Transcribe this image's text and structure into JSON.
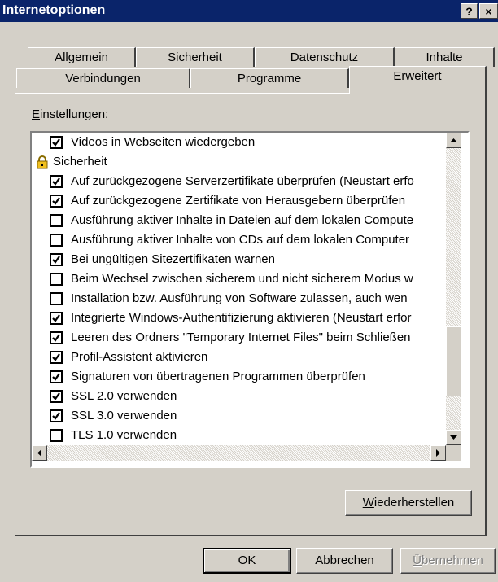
{
  "window": {
    "title": "Internetoptionen",
    "help_button": "?",
    "close_button": "×"
  },
  "tabs": {
    "row_back": [
      "Allgemein",
      "Sicherheit",
      "Datenschutz",
      "Inhalte"
    ],
    "row_front": [
      "Verbindungen",
      "Programme",
      "Erweitert"
    ],
    "active": "Erweitert"
  },
  "settings": {
    "label_accesskey": "E",
    "label_rest": "instellungen:",
    "items": [
      {
        "type": "checkbox",
        "checked": true,
        "label": "Videos in Webseiten wiedergeben"
      },
      {
        "type": "category",
        "icon": "lock-icon",
        "label": "Sicherheit"
      },
      {
        "type": "checkbox",
        "checked": true,
        "label": "Auf zurückgezogene Serverzertifikate überprüfen (Neustart erfo"
      },
      {
        "type": "checkbox",
        "checked": true,
        "label": "Auf zurückgezogene Zertifikate von Herausgebern überprüfen"
      },
      {
        "type": "checkbox",
        "checked": false,
        "label": "Ausführung aktiver Inhalte in Dateien auf dem lokalen Compute"
      },
      {
        "type": "checkbox",
        "checked": false,
        "label": "Ausführung aktiver Inhalte von CDs auf dem lokalen Computer"
      },
      {
        "type": "checkbox",
        "checked": true,
        "label": "Bei ungültigen Sitezertifikaten warnen"
      },
      {
        "type": "checkbox",
        "checked": false,
        "label": "Beim Wechsel zwischen sicherem und nicht sicherem Modus w"
      },
      {
        "type": "checkbox",
        "checked": false,
        "label": "Installation bzw. Ausführung von Software zulassen, auch wen"
      },
      {
        "type": "checkbox",
        "checked": true,
        "label": "Integrierte Windows-Authentifizierung aktivieren (Neustart erfor"
      },
      {
        "type": "checkbox",
        "checked": true,
        "label": "Leeren des Ordners \"Temporary Internet Files\" beim Schließen"
      },
      {
        "type": "checkbox",
        "checked": true,
        "label": "Profil-Assistent aktivieren"
      },
      {
        "type": "checkbox",
        "checked": true,
        "label": "Signaturen von übertragenen Programmen überprüfen"
      },
      {
        "type": "checkbox",
        "checked": true,
        "label": "SSL 2.0 verwenden"
      },
      {
        "type": "checkbox",
        "checked": true,
        "label": "SSL 3.0 verwenden"
      },
      {
        "type": "checkbox",
        "checked": false,
        "label": "TLS 1.0 verwenden"
      }
    ]
  },
  "restore_button": {
    "accesskey": "W",
    "rest": "iederherstellen"
  },
  "footer": {
    "ok": "OK",
    "cancel": "Abbrechen",
    "apply_accesskey": "Ü",
    "apply_rest": "bernehmen"
  }
}
